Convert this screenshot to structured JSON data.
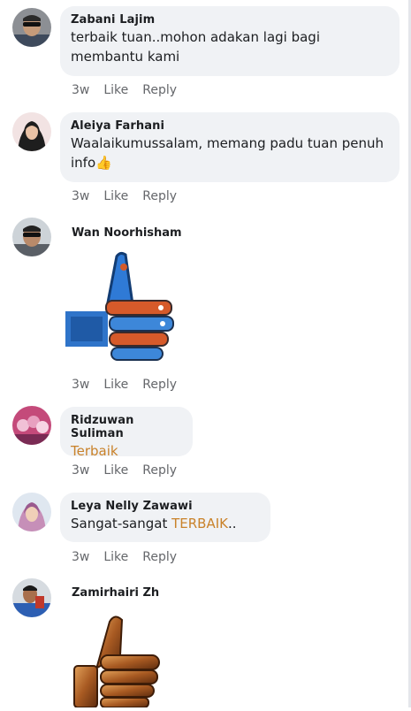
{
  "comments": [
    {
      "name": "Zabani Lajim",
      "text_line1": "terbaik tuan..mohon adakan lagi bagi",
      "text_line2": "membantu kami",
      "time": "3w",
      "like": "Like",
      "reply": "Reply",
      "avatar_icon": "profile-photo-man-sunglasses"
    },
    {
      "name": "Aleiya Farhani",
      "text_line1": "Waalaikumussalam, memang padu tuan penuh",
      "text_line2": "info",
      "emoji": "👍",
      "time": "3w",
      "like": "Like",
      "reply": "Reply",
      "avatar_icon": "profile-photo-woman-hijab"
    },
    {
      "name": "Wan Noorhisham",
      "sticker": "robot-thumbs-up-sticker",
      "time": "3w",
      "like": "Like",
      "reply": "Reply",
      "avatar_icon": "profile-photo-man-sunglasses"
    },
    {
      "name": "Ridzuwan Suliman",
      "text": "Terbaik",
      "time": "3w",
      "like": "Like",
      "reply": "Reply",
      "avatar_icon": "profile-photo-group"
    },
    {
      "name": "Leya Nelly Zawawi",
      "text_prefix": "Sangat-sangat ",
      "text_highlight": "TERBAIK",
      "text_suffix": "..",
      "time": "3w",
      "like": "Like",
      "reply": "Reply",
      "avatar_icon": "profile-photo-woman-hijab"
    },
    {
      "name": "Zamirhairi Zh",
      "sticker": "bronze-thumbs-up-sticker",
      "avatar_icon": "profile-photo-man"
    }
  ],
  "colors": {
    "bubble": "#f0f2f5",
    "meta": "#65676b",
    "highlight": "#c9822a",
    "name": "#1c1e21"
  }
}
